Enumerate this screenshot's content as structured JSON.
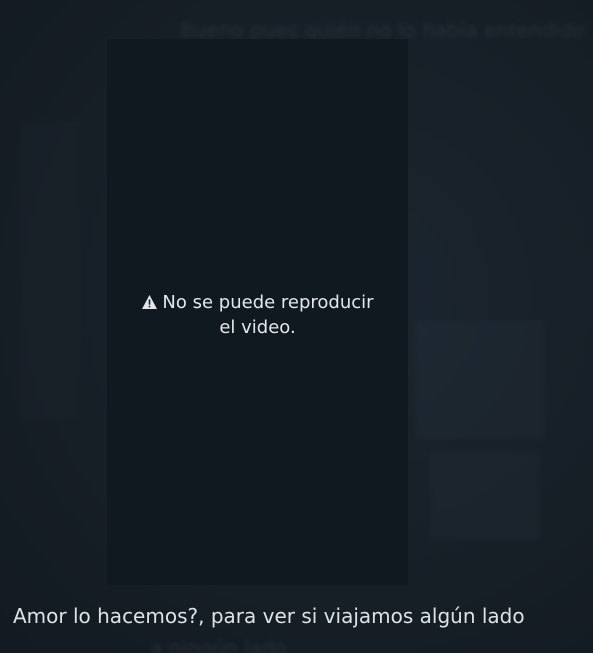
{
  "background": {
    "top_caption": "Bueno pues quién no lo había entendido",
    "bottom_caption": "a ningún lado."
  },
  "video": {
    "error_line1": "No se puede reproducir",
    "error_line2": "el video.",
    "error_icon": "warning-icon",
    "colors": {
      "panel": "#111920",
      "page": "#18212a",
      "text": "#e4e7ea"
    }
  },
  "caption": {
    "text": "Amor lo hacemos?, para ver si viajamos algún lado"
  }
}
